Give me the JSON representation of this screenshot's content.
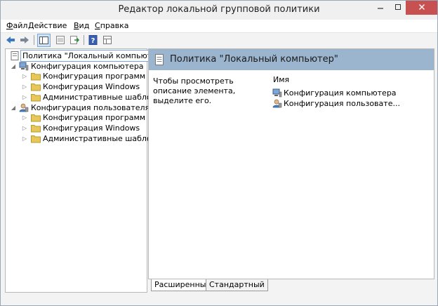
{
  "window": {
    "title": "Редактор локальной групповой политики"
  },
  "menu": {
    "items": [
      {
        "label": "Файл",
        "hot": "Ф",
        "rest": "айл"
      },
      {
        "label": "Действие",
        "hot": "Д",
        "rest": "ействие"
      },
      {
        "label": "Вид",
        "hot": "В",
        "rest": "ид"
      },
      {
        "label": "Справка",
        "hot": "С",
        "rest": "правка"
      }
    ]
  },
  "tree": {
    "root": "Политика \"Локальный компьютер\"",
    "computer": "Конфигурация компьютера",
    "user": "Конфигурация пользователя",
    "children": [
      "Конфигурация программ",
      "Конфигурация Windows",
      "Административные шаблоны"
    ]
  },
  "details": {
    "header": "Политика \"Локальный компьютер\"",
    "description": "Чтобы просмотреть описание элемента, выделите его.",
    "column": "Имя",
    "items": [
      "Конфигурация компьютера",
      "Конфигурация пользовате..."
    ]
  },
  "tabs": [
    "Расширенный",
    "Стандартный"
  ],
  "colors": {
    "header_bg": "#9bb5cf",
    "folder": "#e8c75a",
    "accent": "#3a78c4"
  }
}
